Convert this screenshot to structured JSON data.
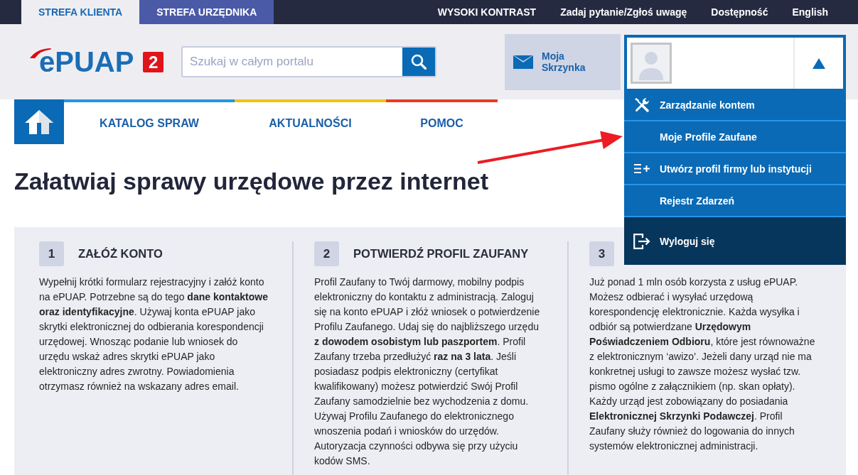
{
  "zone_tabs": [
    {
      "label": "STREFA KLIENTA",
      "selected": true
    },
    {
      "label": "STREFA URZĘDNIKA",
      "selected": false
    }
  ],
  "utility_links": [
    "WYSOKI KONTRAST",
    "Zadaj pytanie/Zgłoś uwagę",
    "Dostępność",
    "English"
  ],
  "header": {
    "logo": {
      "text": "ePUAP",
      "badge": "2"
    },
    "search": {
      "placeholder": "Szukaj w całym portalu"
    },
    "mailbox": {
      "label": "Moja Skrzynka"
    }
  },
  "account_menu": {
    "expanded": true,
    "items": [
      {
        "label": "Zarządzanie kontem",
        "kind": "tools"
      },
      {
        "label": "Moje Profile Zaufane",
        "kind": "plain"
      },
      {
        "label": "Utwórz profil firmy lub instytucji",
        "kind": "create"
      },
      {
        "label": "Rejestr Zdarzeń",
        "kind": "plain"
      },
      {
        "label": "Wyloguj się",
        "kind": "logout"
      }
    ]
  },
  "main_nav": [
    {
      "label": "KATALOG SPRAW",
      "color": "#1e96ec"
    },
    {
      "label": "AKTUALNOŚCI",
      "color": "#f2c40c"
    },
    {
      "label": "POMOC",
      "color": "#ee3b1f"
    }
  ],
  "page_title": "Załatwiaj sprawy urzędowe przez internet",
  "steps": [
    {
      "number": "1",
      "title": "ZAŁÓŻ KONTO",
      "text": "Wypełnij krótki formularz rejestracyjny i załóż konto na ePUAP. Potrzebne są do tego **dane kontaktowe oraz identyfikacyjne**. Używaj konta ePUAP jako skrytki elektronicznej do odbierania korespondencji urzędowej. Wnosząc podanie lub wniosek do urzędu wskaż adres skrytki ePUAP jako elektroniczny adres zwrotny. Powiadomienia otrzymasz również na wskazany adres email."
    },
    {
      "number": "2",
      "title": "POTWIERDŹ PROFIL ZAUFANY",
      "text": "Profil Zaufany to Twój darmowy, mobilny podpis elektroniczny do kontaktu z administracją. Zaloguj się na konto ePUAP i złóż wniosek o potwierdzenie Profilu Zaufanego. Udaj się do najbliższego urzędu **z dowodem osobistym lub paszportem**. Profil Zaufany trzeba przedłużyć **raz na 3 lata**. Jeśli posiadasz podpis elektroniczny (certyfikat kwalifikowany) możesz potwierdzić Swój Profil Zaufany samodzielnie bez wychodzenia z domu. Używaj Profilu Zaufanego do elektronicznego wnoszenia podań i wniosków do urzędów. Autoryzacja czynności odbywa się przy użyciu kodów SMS."
    },
    {
      "number": "3",
      "text": "Już ponad 1 mln osób korzysta z usług ePUAP. Możesz odbierać i wysyłać urzędową korespondencję elektronicznie. Każda wysyłka i odbiór są potwierdzane **Urzędowym Poświadczeniem Odbioru**, które jest równoważne z elektronicznym ‘awizo’. Jeżeli dany urząd nie ma konkretnej usługi to zawsze możesz wysłać tzw. pismo ogólne z załącznikiem (np. skan opłaty). Każdy urząd jest zobowiązany do posiadania **Elektronicznej Skrzynki Podawczej**. Profil Zaufany służy również do logowania do innych systemów elektronicznej administracji."
    }
  ]
}
